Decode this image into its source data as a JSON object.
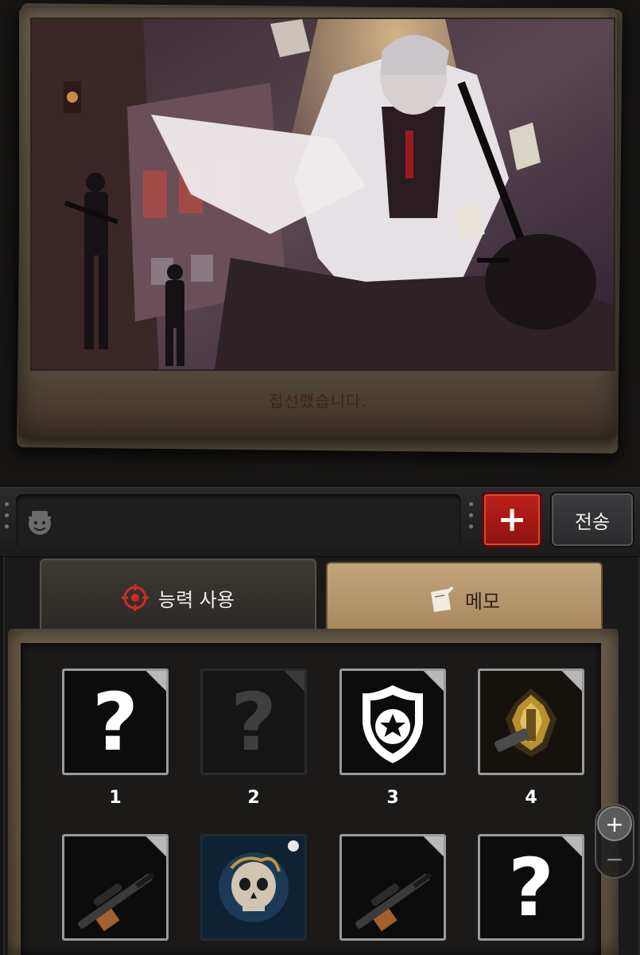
{
  "story": {
    "caption": "접선했습니다."
  },
  "chat": {
    "input_placeholder": "",
    "plus_label": "+",
    "send_label": "전송"
  },
  "tabs": [
    {
      "label": "능력 사용",
      "icon": "crosshair-icon",
      "active": true
    },
    {
      "label": "메모",
      "icon": "memo-icon",
      "active": false
    }
  ],
  "slots": [
    {
      "number": "1",
      "content": "question-icon",
      "state": "unknown"
    },
    {
      "number": "2",
      "content": "question-icon",
      "state": "disabled"
    },
    {
      "number": "3",
      "content": "police-badge-icon",
      "state": "revealed"
    },
    {
      "number": "4",
      "content": "gold-crest-gun-icon",
      "state": "revealed"
    },
    {
      "number": "",
      "content": "sniper-rifle-icon",
      "state": "revealed"
    },
    {
      "number": "",
      "content": "skull-emblem-icon",
      "state": "revealed"
    },
    {
      "number": "",
      "content": "sniper-rifle-icon",
      "state": "revealed"
    },
    {
      "number": "",
      "content": "question-icon",
      "state": "unknown"
    }
  ],
  "zoom": {
    "in_label": "+",
    "out_label": "−"
  },
  "colors": {
    "accent_red": "#c0201b",
    "memo_tab": "#b39470",
    "frame_brown": "#5c5142"
  }
}
